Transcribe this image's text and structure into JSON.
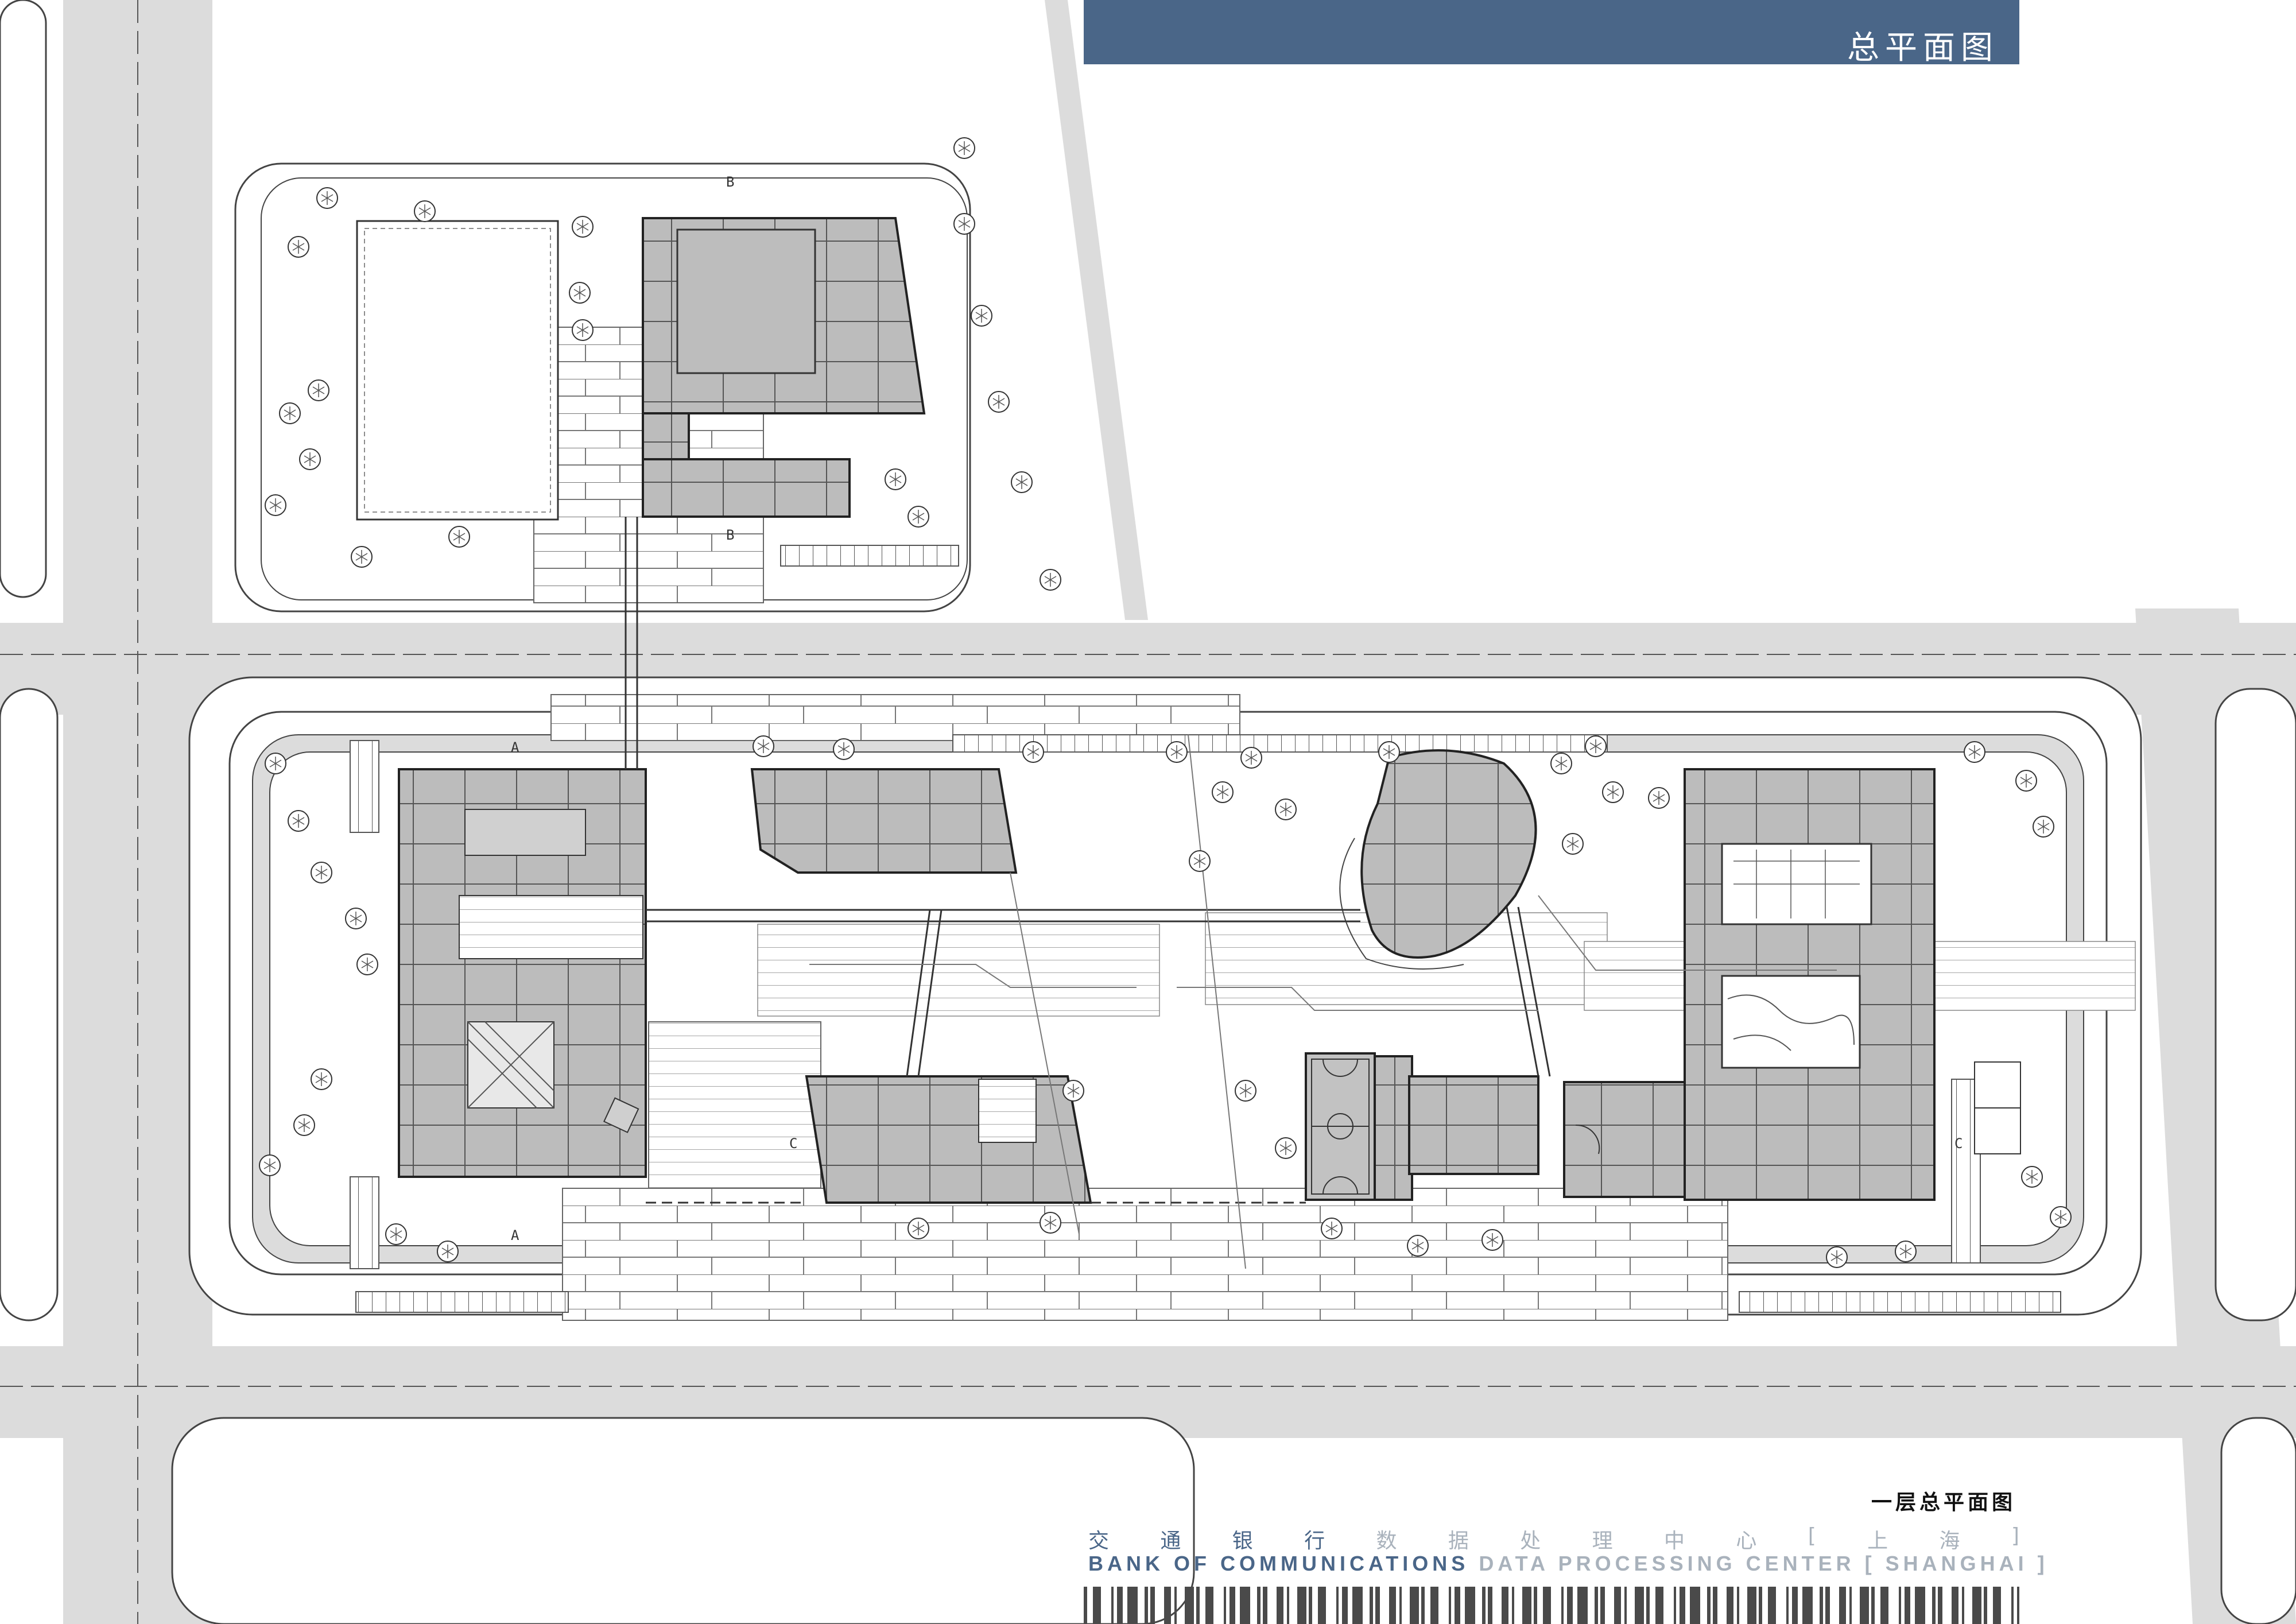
{
  "header": {
    "title": "总平面图"
  },
  "drawing": {
    "subtitle": "一层总平面图",
    "section_marks": [
      "B",
      "B",
      "A",
      "A",
      "C",
      "C"
    ]
  },
  "footer": {
    "cn_name_primary": [
      "交",
      "通",
      "银",
      "行"
    ],
    "cn_name_secondary": [
      "数",
      "据",
      "处",
      "理",
      "中",
      "心",
      "[",
      "上",
      "海",
      "]"
    ],
    "en_name_primary": "BANK OF COMMUNICATIONS",
    "en_name_secondary": "DATA PROCESSING CENTER [ SHANGHAI ]"
  },
  "colors": {
    "banner": "#4a6688",
    "road": "#dcdcdc",
    "building": "#b9b9b9",
    "building_outline": "#333333",
    "accent_text_grey": "#a9b2bc"
  },
  "icons": {
    "tree": "tree-icon",
    "court": "basketball-court-icon"
  }
}
